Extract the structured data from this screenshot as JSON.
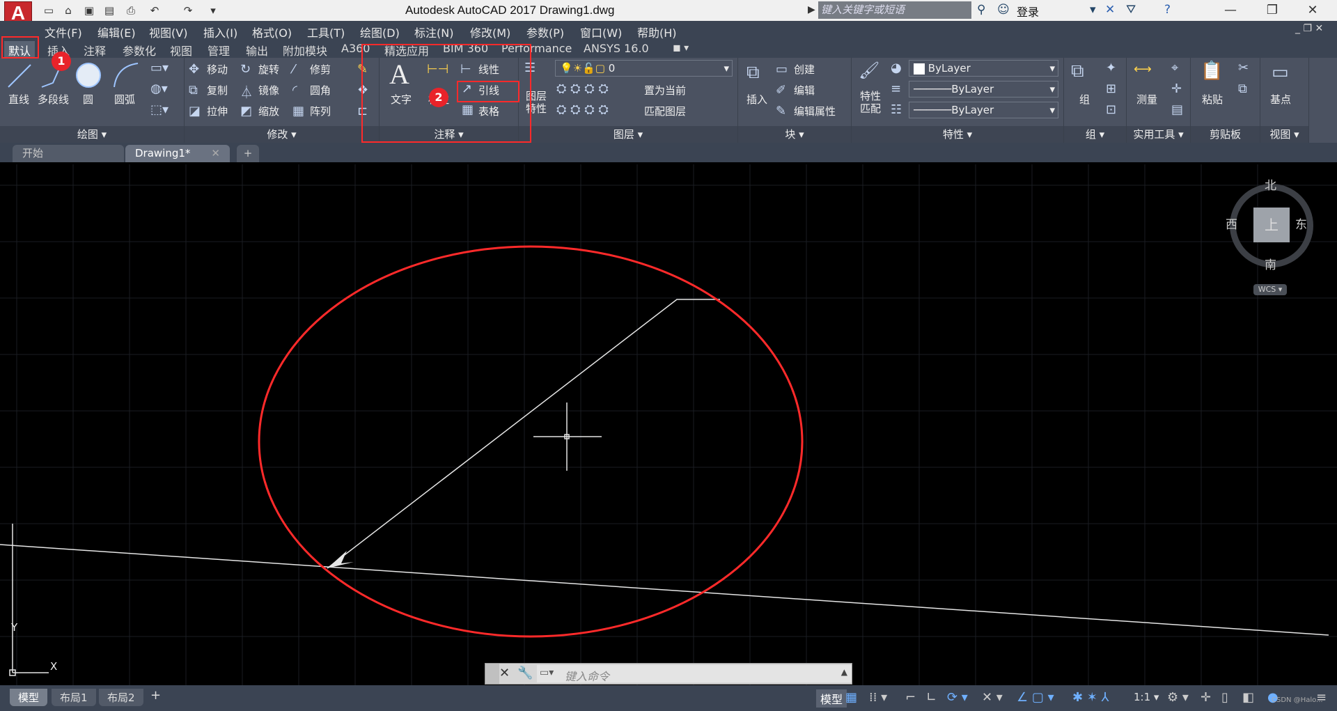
{
  "titlebar": {
    "logo": "A",
    "title": "Autodesk AutoCAD 2017    Drawing1.dwg",
    "search_placeholder": "键入关键字或短语",
    "login": "登录",
    "icons": [
      "new-icon",
      "open-icon",
      "save-icon",
      "saveas-icon",
      "print-icon",
      "undo-icon",
      "redo-icon"
    ]
  },
  "menubar": [
    "文件(F)",
    "编辑(E)",
    "视图(V)",
    "插入(I)",
    "格式(O)",
    "工具(T)",
    "绘图(D)",
    "标注(N)",
    "修改(M)",
    "参数(P)",
    "窗口(W)",
    "帮助(H)"
  ],
  "ribbon_tabs": [
    "默认",
    "插入",
    "注释",
    "参数化",
    "视图",
    "管理",
    "输出",
    "附加模块",
    "A360",
    "精选应用",
    "BIM 360",
    "Performance",
    "ANSYS 16.0"
  ],
  "ribbon": {
    "draw": {
      "title": "绘图",
      "items": [
        "直线",
        "多段线",
        "圆",
        "圆弧"
      ]
    },
    "modify": {
      "title": "修改",
      "items": [
        "移动",
        "旋转",
        "修剪",
        "复制",
        "镜像",
        "圆角",
        "拉伸",
        "缩放",
        "阵列"
      ]
    },
    "annotation": {
      "title": "注释",
      "text": "文字",
      "dim": "标注",
      "linear": "线性",
      "leader": "引线",
      "table": "表格"
    },
    "layers": {
      "title": "图层",
      "props": "图层\n特性",
      "layer_value": "0",
      "set_current": "置为当前",
      "match": "匹配图层"
    },
    "block": {
      "title": "块",
      "insert": "插入",
      "create": "创建",
      "edit": "编辑",
      "edit_attr": "编辑属性"
    },
    "properties": {
      "title": "特性",
      "match": "特性\n匹配",
      "color": "ByLayer",
      "linetype": "ByLayer",
      "lineweight": "ByLayer"
    },
    "groups": {
      "title": "组",
      "label": "组"
    },
    "utilities": {
      "title": "实用工具",
      "measure": "测量"
    },
    "clipboard": {
      "title": "剪贴板",
      "paste": "粘贴"
    },
    "view": {
      "title": "视图",
      "base": "基点"
    }
  },
  "doc_tabs": [
    "开始",
    "Drawing1*"
  ],
  "viewcube": {
    "north": "北",
    "south": "南",
    "east": "东",
    "west": "西",
    "top": "上",
    "wcs": "WCS"
  },
  "ucs": {
    "y": "Y",
    "x": "X"
  },
  "command": {
    "placeholder": "键入命令"
  },
  "layout_tabs": [
    "模型",
    "布局1",
    "布局2"
  ],
  "status": {
    "model": "模型",
    "scale": "1:1"
  },
  "badges": [
    "1",
    "2"
  ],
  "watermark": "CSDN @Halo..."
}
